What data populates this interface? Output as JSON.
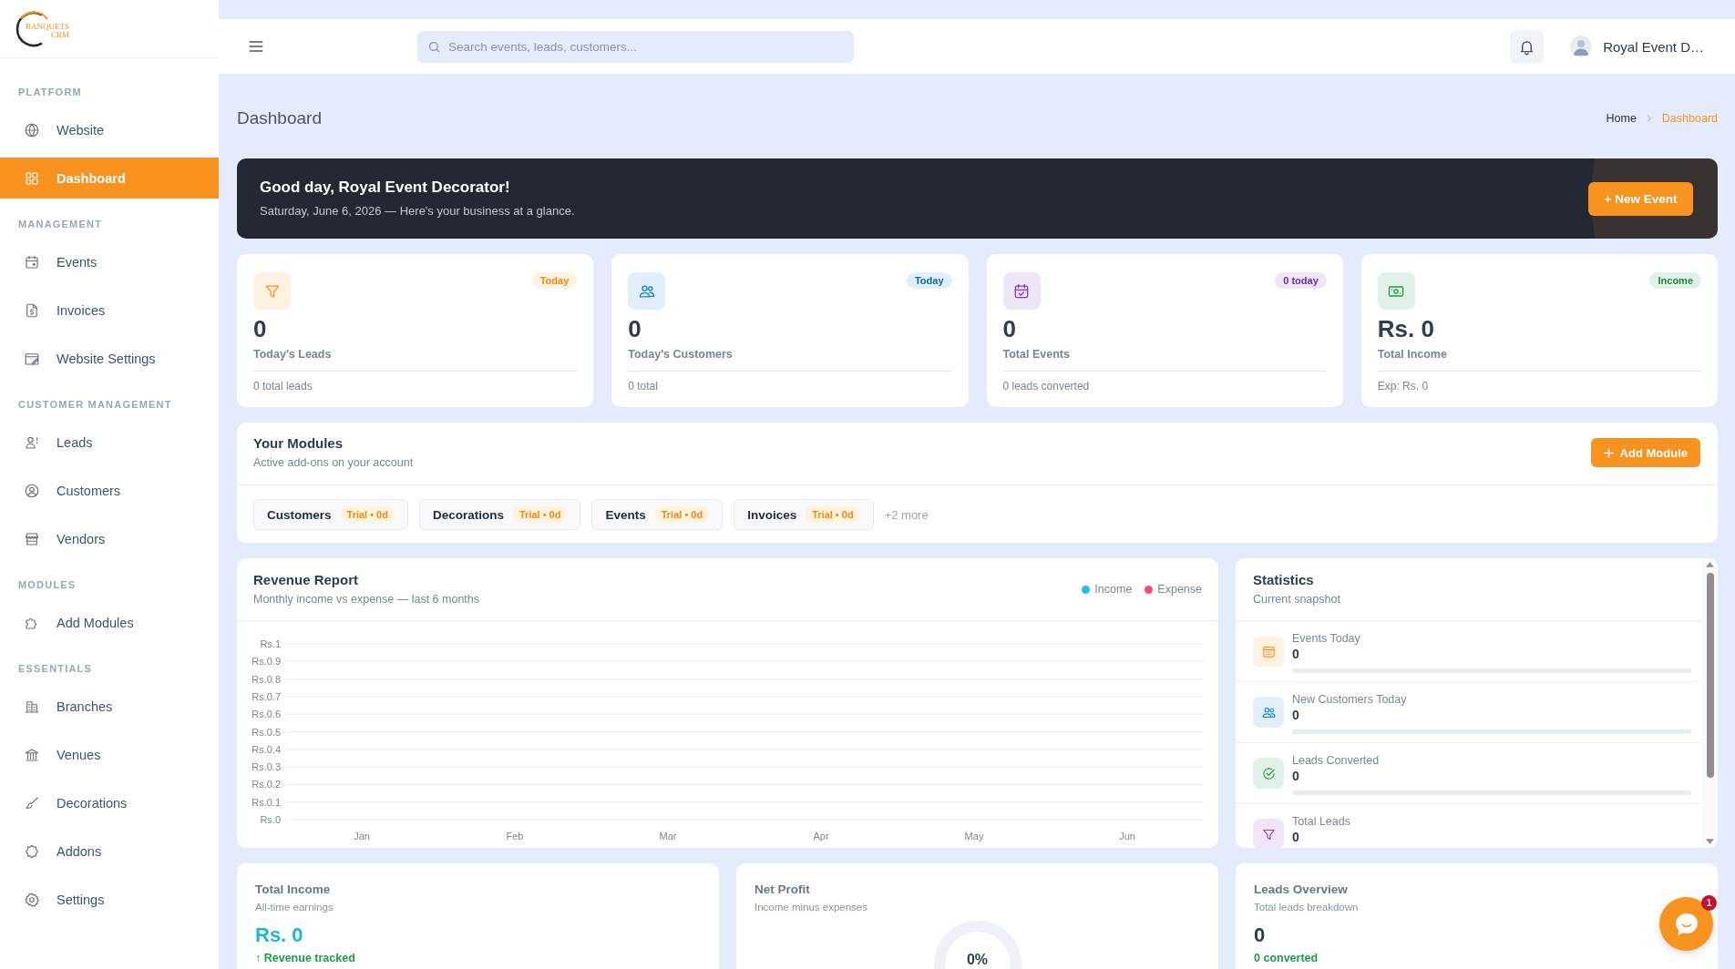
{
  "sidebar": {
    "logo": {
      "line_1": "BANQUETS",
      "line_2": "CRM"
    },
    "sections": [
      {
        "title": "PLATFORM",
        "items": [
          {
            "label": "Website",
            "selected": false
          },
          {
            "label": "Dashboard",
            "selected": true
          }
        ]
      },
      {
        "title": "MANAGEMENT",
        "items": [
          {
            "label": "Events",
            "selected": false
          },
          {
            "label": "Invoices",
            "selected": false
          },
          {
            "label": "Website Settings",
            "selected": false
          }
        ]
      },
      {
        "title": "CUSTOMER MANAGEMENT",
        "items": [
          {
            "label": "Leads",
            "selected": false
          },
          {
            "label": "Customers",
            "selected": false
          },
          {
            "label": "Vendors",
            "selected": false
          }
        ]
      },
      {
        "title": "MODULES",
        "items": [
          {
            "label": "Add Modules",
            "selected": false
          }
        ]
      },
      {
        "title": "ESSENTIALS",
        "items": [
          {
            "label": "Branches",
            "selected": false
          },
          {
            "label": "Venues",
            "selected": false
          },
          {
            "label": "Decorations",
            "selected": false
          },
          {
            "label": "Addons",
            "selected": false
          },
          {
            "label": "Settings",
            "selected": false
          }
        ]
      }
    ]
  },
  "topbar": {
    "search": {
      "placeholder": "Search events, leads, customers..."
    },
    "user": {
      "name": "Royal Event D…"
    }
  },
  "page_header": {
    "title": "Dashboard",
    "breadcrumb": [
      {
        "label": "Home",
        "current": false
      },
      {
        "label": "Dashboard",
        "current": true
      }
    ]
  },
  "banner": {
    "title": "Good day, Royal Event Decorator!",
    "subtitle": "Saturday, June 6, 2026 — Here's your business at a glance.",
    "button": "+ New Event"
  },
  "stat_cards": [
    {
      "value": "0",
      "label": "Today's Leads",
      "footer": "0 total leads",
      "badge": "Today",
      "color": "#f7931e"
    },
    {
      "value": "0",
      "label": "Today's Customers",
      "footer": "0 total",
      "badge": "Today",
      "color": "#1487d4"
    },
    {
      "value": "0",
      "label": "Total Events",
      "footer": "0 leads converted",
      "badge": "0 today",
      "color": "#7e3fc4"
    },
    {
      "value": "Rs. 0",
      "label": "Total Income",
      "footer": "Exp: Rs. 0",
      "badge": "Income",
      "color": "#22994a"
    }
  ],
  "modules": {
    "title": "Your Modules",
    "subtitle": "Active add-ons on your account",
    "button": "Add Module",
    "items": [
      {
        "name": "Customers",
        "status": "Trial • 0d"
      },
      {
        "name": "Decorations",
        "status": "Trial • 0d"
      },
      {
        "name": "Events",
        "status": "Trial • 0d"
      },
      {
        "name": "Invoices",
        "status": "Trial • 0d"
      }
    ],
    "more": "+2 more"
  },
  "revenue_report": {
    "title": "Revenue Report",
    "subtitle": "Monthly income vs expense — last 6 months",
    "legend": [
      {
        "label": "Income",
        "color": "#22c1e0"
      },
      {
        "label": "Expense",
        "color": "#ff4f6e"
      }
    ],
    "chart": {
      "y_labels": [
        "Rs.1",
        "Rs.0.9",
        "Rs.0.8",
        "Rs.0.7",
        "Rs.0.6",
        "Rs.0.5",
        "Rs.0.4",
        "Rs.0.3",
        "Rs.0.2",
        "Rs.0.1",
        "Rs.0"
      ],
      "x_labels": [
        "Jan",
        "Feb",
        "Mar",
        "Apr",
        "May",
        "Jun"
      ]
    }
  },
  "statistics": {
    "title": "Statistics",
    "subtitle": "Current snapshot",
    "items": [
      {
        "label": "Events Today",
        "value": "0",
        "level": 0,
        "color": "#f7931e"
      },
      {
        "label": "New Customers Today",
        "value": "0",
        "level": 0,
        "color": "#1487d4"
      },
      {
        "label": "Leads Converted",
        "value": "0",
        "level": 0,
        "color": "#22994a"
      },
      {
        "label": "Total Leads",
        "value": "0",
        "color": "#8e44c8"
      }
    ]
  },
  "summary_cards": [
    {
      "kind": "amount",
      "title": "Total Income",
      "subtitle": "All-time earnings",
      "value": "Rs. 0",
      "note": "↑ Revenue tracked"
    },
    {
      "kind": "donut",
      "title": "Net Profit",
      "subtitle": "Income minus expenses",
      "center": "0%"
    },
    {
      "kind": "count",
      "title": "Leads Overview",
      "subtitle": "Total leads breakdown",
      "value": "0",
      "note": "0 converted"
    }
  ],
  "chat": {
    "badge": "1"
  }
}
